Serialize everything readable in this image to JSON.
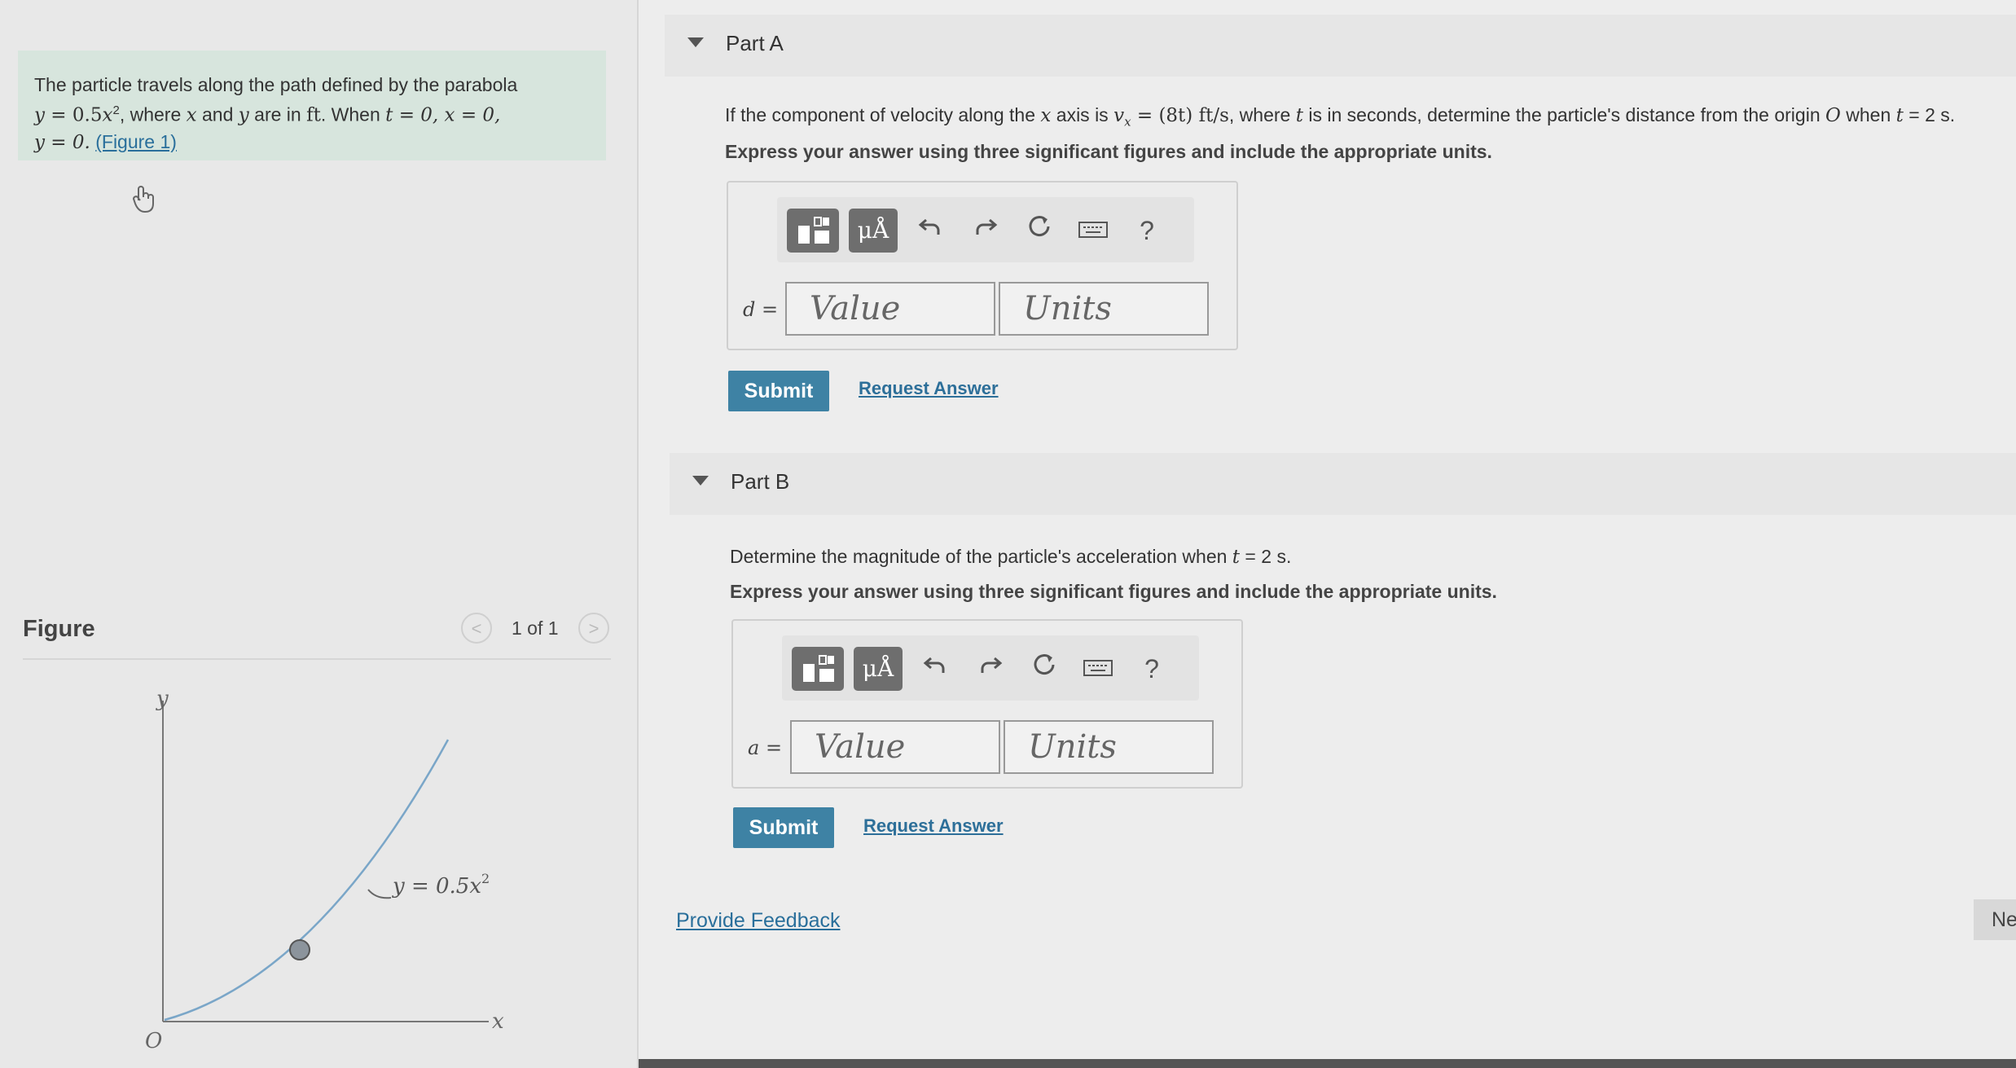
{
  "problem": {
    "text1": "The particle travels along the path defined by the parabola",
    "eq_y": "y",
    "eq_eq": " = 0.5",
    "eq_x": "x",
    "eq_exp": "2",
    "text2": ", where ",
    "x_var": "x",
    "text3": " and ",
    "y_var": "y",
    "text4": " are in ",
    "ft": "ft",
    "text5": ". When ",
    "t0": "t = 0, x = 0,",
    "y0": "y = 0.",
    "figure_link": "(Figure 1)"
  },
  "figure": {
    "title": "Figure",
    "pager": "1 of 1",
    "prev": "<",
    "next": ">",
    "axis_y": "y",
    "axis_x": "x",
    "origin": "O",
    "curve_label": "y = 0.5x",
    "curve_exp": "2"
  },
  "partA": {
    "title": "Part A",
    "question_pre": "If the component of velocity along the ",
    "q_x": "x",
    "question_mid": " axis is ",
    "q_vx": "v",
    "q_vx_sub": "x",
    "q_formula": " = (8t)  ft/s",
    "question_post": ", where ",
    "q_t": "t",
    "question_post2": " is in seconds, determine the particle's distance from the origin ",
    "q_O": "O",
    "question_post3": " when ",
    "q_t2": "t",
    "question_end": " = 2 s.",
    "instruction": "Express your answer using three significant figures and include the appropriate units.",
    "var_label": "d =",
    "value_placeholder": "Value",
    "units_placeholder": "Units",
    "submit": "Submit",
    "request": "Request Answer"
  },
  "partB": {
    "title": "Part B",
    "question_pre": "Determine the magnitude of the particle's acceleration when ",
    "q_t": "t",
    "question_end": " = 2 s.",
    "instruction": "Express your answer using three significant figures and include the appropriate units.",
    "var_label": "a =",
    "value_placeholder": "Value",
    "units_placeholder": "Units",
    "submit": "Submit",
    "request": "Request Answer"
  },
  "toolbar": {
    "mu_label": "μÅ",
    "help": "?"
  },
  "footer": {
    "feedback": "Provide Feedback",
    "next": "Ne"
  },
  "icons": {
    "templates": "templates-icon",
    "undo": "undo-icon",
    "redo": "redo-icon",
    "reset": "reset-icon",
    "keyboard": "keyboard-icon",
    "cursor": "hand-cursor-icon"
  }
}
